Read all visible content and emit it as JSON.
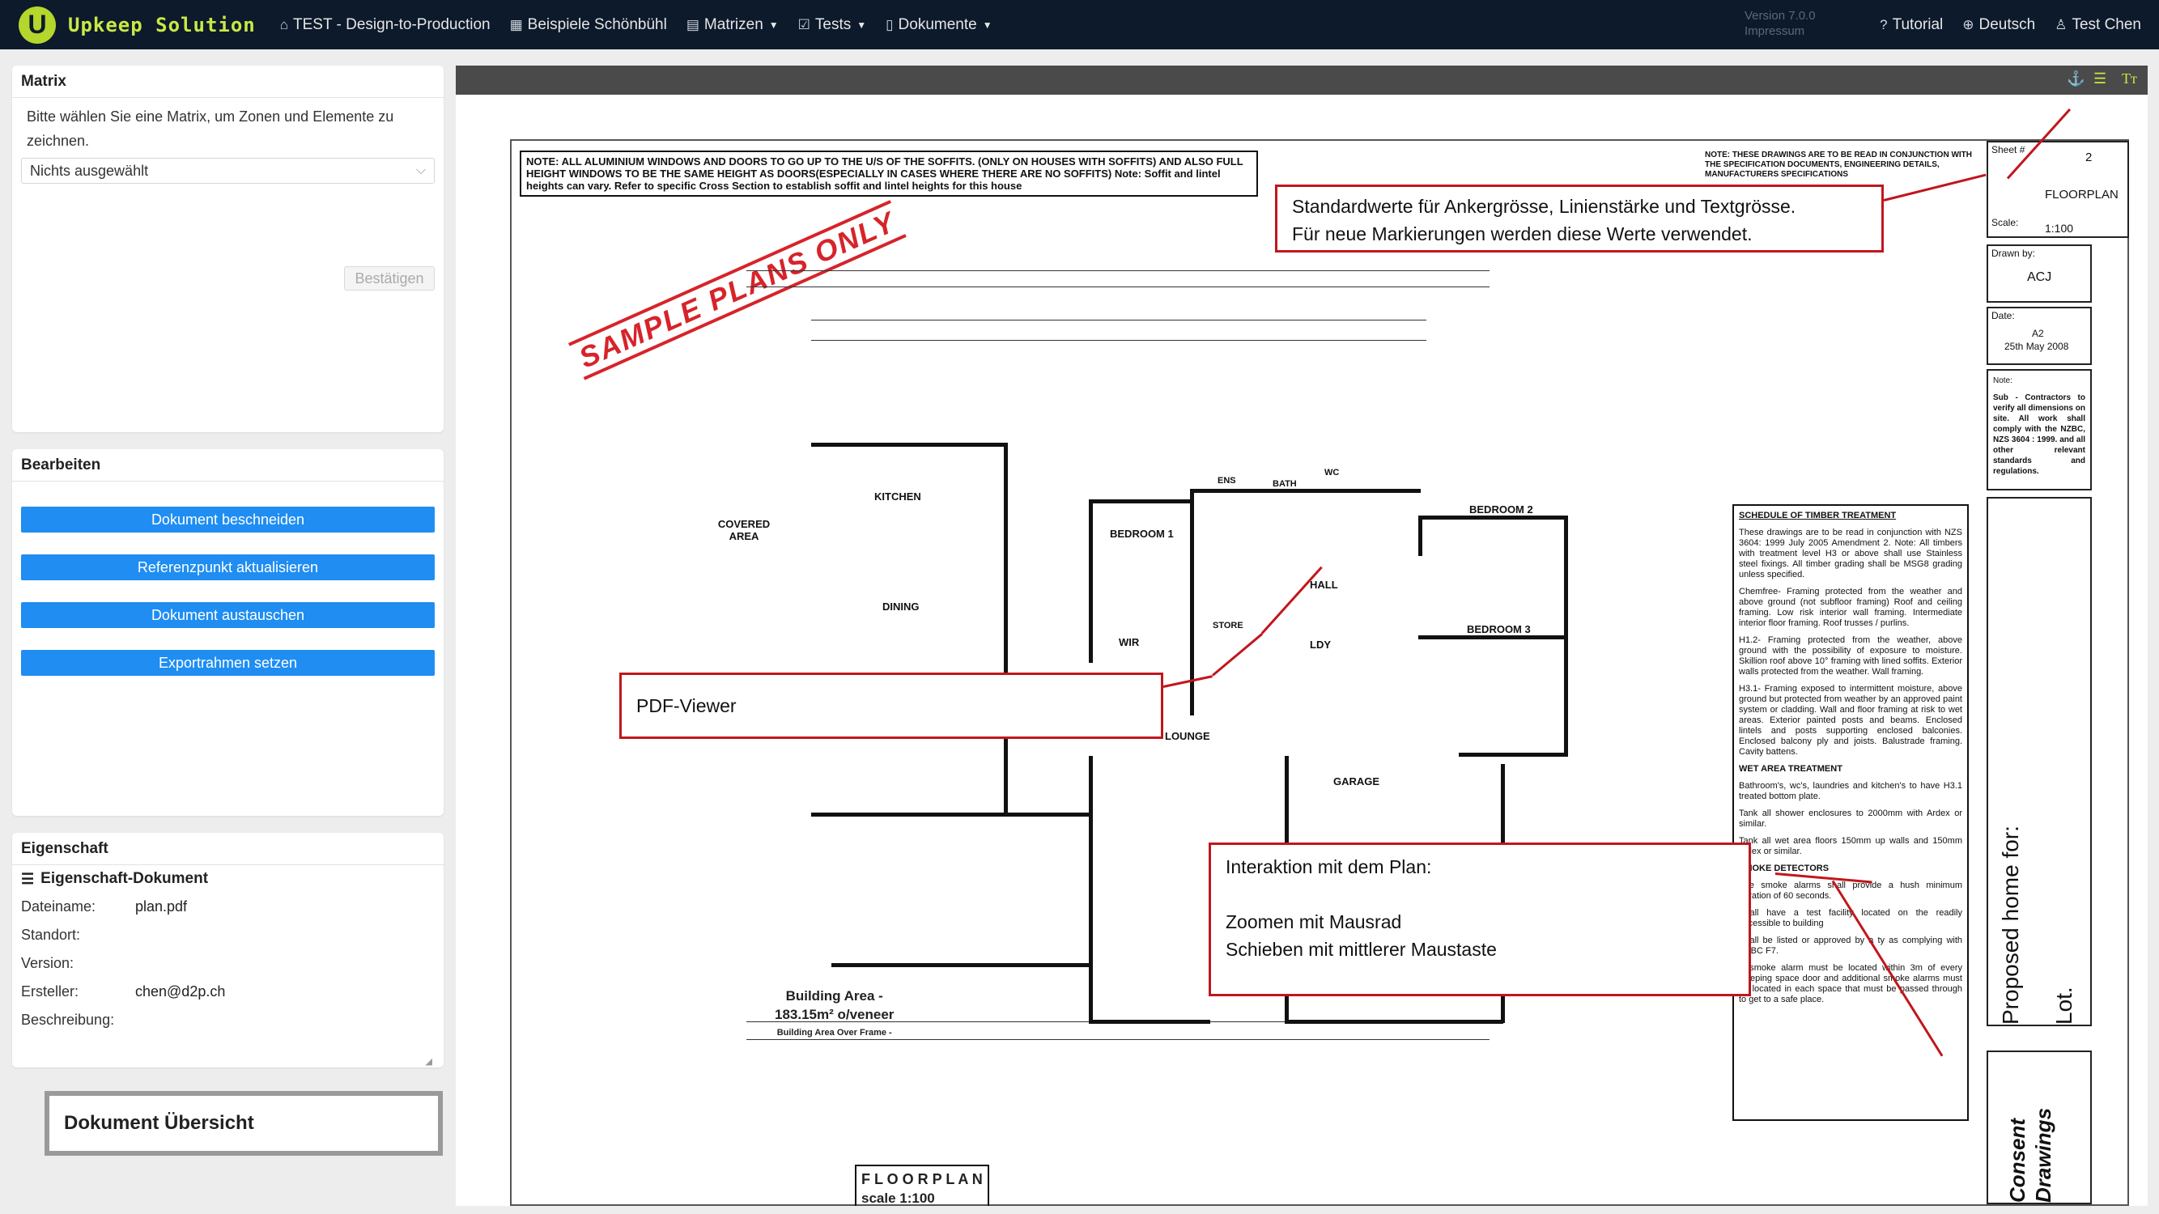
{
  "navbar": {
    "brand": "Upkeep Solution",
    "logo_letter": "U",
    "items": [
      {
        "icon": "home-icon",
        "glyph": "⌂",
        "label": "TEST - Design-to-Production",
        "caret": false
      },
      {
        "icon": "grid-icon",
        "glyph": "▦",
        "label": "Beispiele Schönbühl",
        "caret": false
      },
      {
        "icon": "table-icon",
        "glyph": "▤",
        "label": "Matrizen",
        "caret": true
      },
      {
        "icon": "checklist-icon",
        "glyph": "☑",
        "label": "Tests",
        "caret": true
      },
      {
        "icon": "document-icon",
        "glyph": "▯",
        "label": "Dokumente",
        "caret": true
      }
    ],
    "version": "Version 7.0.0",
    "impressum": "Impressum",
    "right": [
      {
        "icon": "help-icon",
        "glyph": "?",
        "label": "Tutorial"
      },
      {
        "icon": "globe-icon",
        "glyph": "⊕",
        "label": "Deutsch"
      },
      {
        "icon": "user-icon",
        "glyph": "♙",
        "label": "Test Chen"
      }
    ]
  },
  "matrix_panel": {
    "title": "Matrix",
    "description": "Bitte wählen Sie eine Matrix, um Zonen und Elemente zu zeichnen.",
    "select_value": "Nichts ausgewählt",
    "confirm_label": "Bestätigen"
  },
  "edit_panel": {
    "title": "Bearbeiten",
    "buttons": [
      "Dokument beschneiden",
      "Referenzpunkt aktualisieren",
      "Dokument austauschen",
      "Exportrahmen setzen"
    ]
  },
  "property_panel": {
    "title": "Eigenschaft",
    "subtitle": "Eigenschaft-Dokument",
    "rows": [
      {
        "key": "Dateiname:",
        "value": "plan.pdf"
      },
      {
        "key": "Standort:",
        "value": ""
      },
      {
        "key": "Version:",
        "value": ""
      },
      {
        "key": "Ersteller:",
        "value": "chen@d2p.ch"
      },
      {
        "key": "Beschreibung:",
        "value": ""
      }
    ]
  },
  "overview_label": "Dokument Übersicht",
  "callouts": {
    "defaults": [
      "Standardwerte für Ankergrösse, Linienstärke und Textgrösse.",
      "Für neue Markierungen werden diese Werte verwendet."
    ],
    "viewer": "PDF-Viewer",
    "interaction": [
      "Interaktion mit dem Plan:",
      "",
      "Zoomen mit Mausrad",
      "Schieben mit mittlerer Maustaste"
    ]
  },
  "plan": {
    "note": "NOTE: ALL ALUMINIUM WINDOWS AND DOORS TO GO UP TO THE U/S OF THE SOFFITS. (ONLY ON HOUSES WITH SOFFITS) AND ALSO FULL HEIGHT WINDOWS TO BE THE SAME HEIGHT AS DOORS(ESPECIALLY IN CASES WHERE THERE ARE NO SOFFITS) Note: Soffit and lintel heights can vary. Refer to specific Cross Section to establish soffit and lintel heights for this house",
    "note2": "NOTE: THESE DRAWINGS ARE TO BE READ IN CONJUNCTION WITH THE SPECIFICATION DOCUMENTS, ENGINEERING DETAILS, MANUFACTURERS SPECIFICATIONS",
    "stamp": "SAMPLE PLANS ONLY",
    "sheet_label": "Sheet #",
    "sheet_no": "2",
    "sheet_name": "FLOORPLAN",
    "scale_label": "Scale:",
    "scale_value": "1:100",
    "drawn_label": "Drawn by:",
    "drawn_value": "ACJ",
    "date_label": "Date:",
    "date_value1": "A2",
    "date_value2": "25th May 2008",
    "note_label": "Note:",
    "note_text": "Sub - Contractors to verify all dimensions on site. All work shall comply with the NZBC, NZS 3604 : 1999. and all other relevant standards and regulations.",
    "proposed": "Proposed home for:",
    "lot": "Lot.",
    "consent": [
      "Consent",
      "Drawings"
    ],
    "rooms": [
      "COVERED AREA",
      "KITCHEN",
      "DINING",
      "BEDROOM 1",
      "ENS",
      "BATH",
      "WC",
      "BEDROOM 2",
      "HALL",
      "BEDROOM 3",
      "STORE",
      "WIR",
      "LDY",
      "LOUNGE",
      "GARAGE"
    ],
    "area_title": "Building Area -",
    "area_value": "183.15m² o/veneer",
    "area_sub": "Building Area Over Frame -",
    "floorplan_title": "F L O O R P L A N",
    "floorplan_scale": "scale 1:100",
    "schedule_title": "SCHEDULE OF TIMBER TREATMENT",
    "schedule": [
      "These drawings are to be read in conjunction with NZS 3604: 1999 July 2005 Amendment 2. Note: All timbers with treatment level H3 or above shall use Stainless steel fixings. All timber grading shall be MSG8 grading unless specified.",
      "Chemfree- Framing protected from the weather and above ground (not subfloor framing) Roof and ceiling framing. Low risk interior wall framing. Intermediate interior floor framing. Roof trusses / purlins.",
      "H1.2- Framing protected from the weather, above ground with the possibility of exposure to moisture. Skillion roof above 10° framing with lined soffits. Exterior walls protected from the weather. Wall framing.",
      "H3.1- Framing exposed to intermittent moisture, above ground but protected from weather by an approved paint system or cladding. Wall and floor framing at risk to wet areas. Exterior painted posts and beams. Enclosed lintels and posts supporting enclosed balconies. Enclosed balcony ply and joists. Balustrade framing. Cavity battens.",
      "WET AREA TREATMENT",
      "Bathroom's, wc's, laundries and kitchen's to have H3.1 treated bottom plate.",
      "Tank all shower enclosures to 2000mm with Ardex or similar.",
      "Tank all wet area floors 150mm up walls and 150mm ardex or similar.",
      "SMOKE DETECTORS",
      "The smoke alarms shall provide a hush minimum duration of 60 seconds.",
      "Shall have a test facility located on the readily accessible to building",
      "Shall be listed or approved by a ty as complying with NZBC F7.",
      "A smoke alarm must be located within 3m of every sleeping space door and additional smoke alarms must be located in each space that must be passed through to get to a safe place."
    ]
  }
}
